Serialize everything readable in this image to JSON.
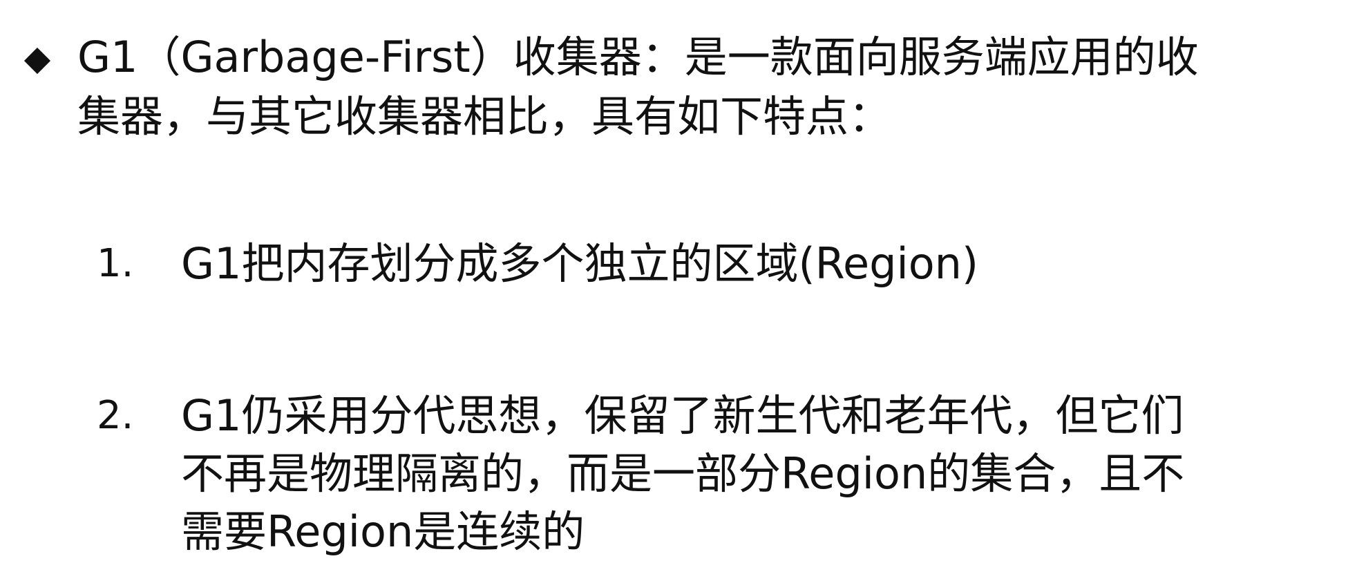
{
  "intro": {
    "bullet": "◆",
    "line1": "G1（Garbage-First）收集器：是一款面向服务端应用的收",
    "line2": "集器，与其它收集器相比，具有如下特点："
  },
  "items": [
    {
      "number": "1.",
      "lines": [
        "G1把内存划分成多个独立的区域(Region)"
      ]
    },
    {
      "number": "2.",
      "lines": [
        "G1仍采用分代思想，保留了新生代和老年代，但它们",
        "不再是物理隔离的，而是一部分Region的集合，且不",
        "需要Region是连续的"
      ]
    }
  ]
}
